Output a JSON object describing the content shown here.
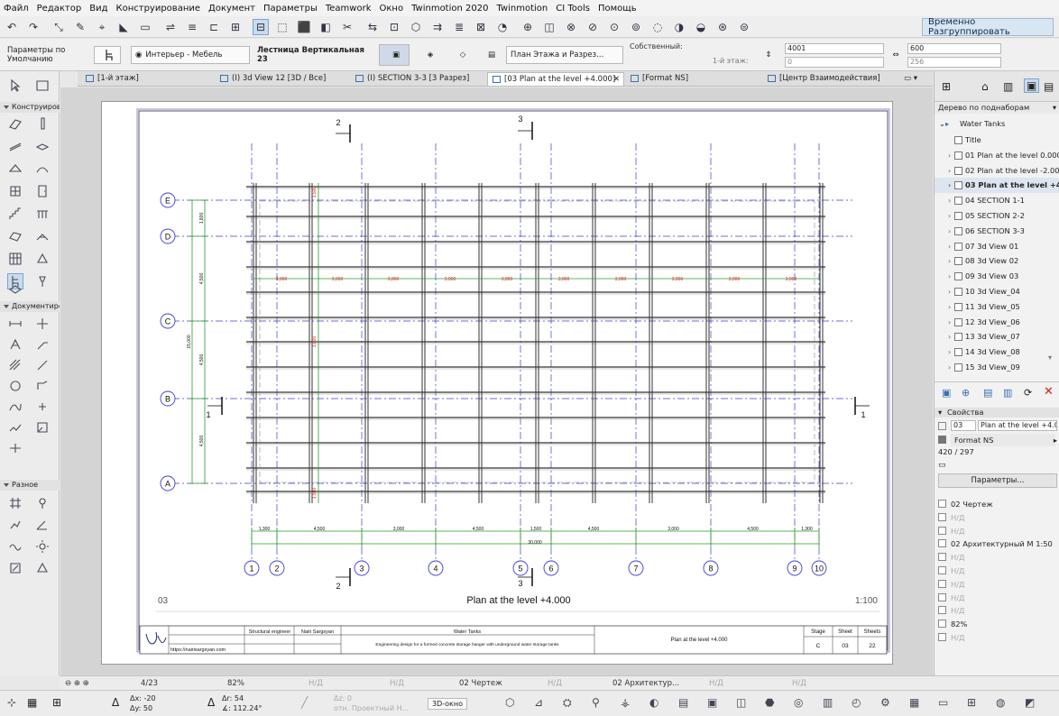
{
  "menu": [
    "Файл",
    "Редактор",
    "Вид",
    "Конструирование",
    "Документ",
    "Параметры",
    "Teamwork",
    "Окно",
    "Twinmotion 2020",
    "Twinmotion",
    "CI Tools",
    "Помощь"
  ],
  "toolbar": {
    "regroup_label": "Временно Разгруппировать"
  },
  "infobox": {
    "defaults": "Параметры по Умолчанию",
    "interior": "Интерьер - Мебель",
    "object_name": "Лестница Вертикальная 23",
    "view_mode": "План Этажа и Разрез...",
    "own_label": "Собственный:",
    "story_label": "1-й этаж:",
    "elev_top": "4001",
    "elev_bot": "0",
    "size_top": "600",
    "size_bot": "256"
  },
  "tabs": [
    {
      "label": "[1-й этаж]"
    },
    {
      "label": "(I) 3d View 12 [3D / Все]"
    },
    {
      "label": "(I) SECTION 3-3 [3 Разрез]"
    },
    {
      "label": "[03 Plan at the level +4.000]"
    },
    {
      "label": "[Format NS]"
    },
    {
      "label": "[Центр Взаимодействия]"
    }
  ],
  "toolbox": {
    "sections": [
      "Конструирование",
      "Документирование",
      "Разное"
    ]
  },
  "drawing": {
    "rows": [
      "E",
      "D",
      "C",
      "B",
      "A"
    ],
    "cols": [
      "1",
      "2",
      "3",
      "4",
      "5",
      "6",
      "7",
      "8",
      "9",
      "10"
    ],
    "dims_bottom": [
      "1,300",
      "4,500",
      "3,000",
      "4,500",
      "1,500",
      "4,500",
      "3,000",
      "4,500",
      "1,300"
    ],
    "dim_total": "30,000",
    "dims_left": [
      "1,800",
      "4,500",
      "4,500",
      "4,500"
    ],
    "dim_left_total": "15,000",
    "dims_red": [
      "3,000",
      "3,000",
      "3,000",
      "3,000",
      "3,000",
      "3,000",
      "3,000",
      "3,000",
      "3,000",
      "3,000"
    ],
    "red_vert": [
      "1,500",
      "3,000",
      "1,500"
    ],
    "section_marks": [
      "2",
      "3",
      "1",
      "1",
      "2",
      "3"
    ],
    "view_number": "03",
    "view_title": "Plan at the level +4.000",
    "scale": "1:100"
  },
  "titleblock": {
    "role": "Structural engineer",
    "name": "Nairi Sargsyan",
    "website": "https://nairisargsyan.com",
    "project": "Water Tanks",
    "description": "Engineering design for a formed concrete storage hanger with underground water storage tanks",
    "sheet_title": "Plan at the level +4.000",
    "stage_label": "Stage",
    "sheet_label": "Sheet",
    "sheets_label": "Sheets",
    "stage": "C",
    "sheet": "03",
    "sheets": "22"
  },
  "navigator": {
    "header": "Дерево по поднаборам",
    "root": "Water Tanks",
    "items": [
      "Title",
      "01 Plan at the level 0.000",
      "02 Plan at the level -2.000",
      "03 Plan at the level +4.000",
      "04 SECTION 1-1",
      "05 SECTION 2-2",
      "06 SECTION 3-3",
      "07 3d View 01",
      "08 3d View 02",
      "09 3d View 03",
      "10 3d View_04",
      "11 3d View_05",
      "12 3d View_06",
      "13 3d View_07",
      "14 3d View_08",
      "15 3d View_09"
    ]
  },
  "properties": {
    "header": "Свойства",
    "id": "03",
    "name": "Plan at the level +4.000",
    "format": "Format NS",
    "size": "420 / 297",
    "params_button": "Параметры...",
    "rows": [
      {
        "text": "02 Чертеж",
        "dim": false
      },
      {
        "text": "Н/Д",
        "dim": true
      },
      {
        "text": "Н/Д",
        "dim": true
      },
      {
        "text": "02 Архитектурный М 1:50",
        "dim": false
      },
      {
        "text": "Н/Д",
        "dim": true
      },
      {
        "text": "Н/Д",
        "dim": true
      },
      {
        "text": "Н/Д",
        "dim": true
      },
      {
        "text": "Н/Д",
        "dim": true
      },
      {
        "text": "Н/Д",
        "dim": true
      },
      {
        "text": "82%",
        "dim": false
      },
      {
        "text": "Н/Д",
        "dim": true
      }
    ]
  },
  "statusbar": {
    "page": "4/23",
    "zoom": "82%",
    "nd1": "Н/Д",
    "nd2": "Н/Д",
    "layer": "02 Чертеж",
    "nd3": "Н/Д",
    "layer2": "02 Архитектур...",
    "nd4": "Н/Д",
    "nd5": "Н/Д"
  },
  "coords": {
    "dx": "Δx: -20",
    "dy": "Δy: 50",
    "dr": "Δr: 54",
    "da": "∡: 112.24°",
    "dz": "Δz: 0",
    "ref": "отн. Проектный Н...",
    "threed": "3D-окно"
  }
}
